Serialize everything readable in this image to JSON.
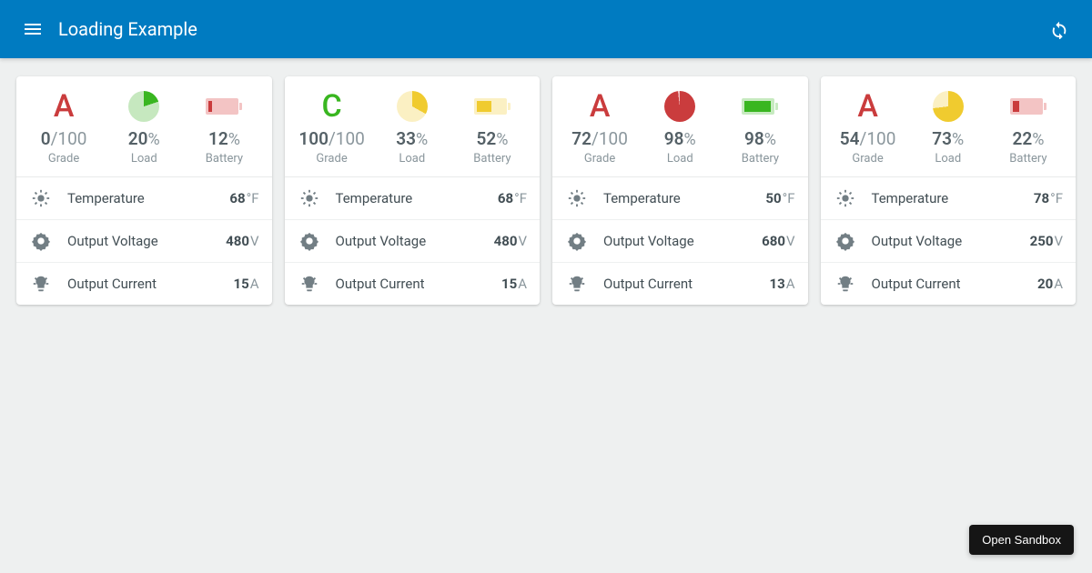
{
  "appbar": {
    "title": "Loading Example"
  },
  "sandbox_button": "Open Sandbox",
  "colors": {
    "red": "#ca3c3d",
    "green": "#39b620",
    "yellow": "#f0cb2f",
    "pieTrackGreen": "#c6e8bf",
    "pieTrackYellow": "#fbf0c3"
  },
  "labels": {
    "grade": "Grade",
    "load": "Load",
    "battery": "Battery",
    "temperature": "Temperature",
    "voltage": "Output Voltage",
    "current": "Output Current",
    "pct": "%",
    "maxGrade": "/100",
    "degF": "°F",
    "volt": "V",
    "amp": "A"
  },
  "cards": [
    {
      "grade": {
        "letter": "A",
        "color": "red",
        "value": 0
      },
      "load": {
        "percent": 20,
        "color": "green"
      },
      "battery": {
        "percent": 12,
        "color": "red"
      },
      "metrics": {
        "temperature": 68,
        "voltage": 480,
        "current": 15
      }
    },
    {
      "grade": {
        "letter": "C",
        "color": "green",
        "value": 100
      },
      "load": {
        "percent": 33,
        "color": "yellow"
      },
      "battery": {
        "percent": 52,
        "color": "yellow"
      },
      "metrics": {
        "temperature": 68,
        "voltage": 480,
        "current": 15
      }
    },
    {
      "grade": {
        "letter": "A",
        "color": "red",
        "value": 72
      },
      "load": {
        "percent": 98,
        "color": "red"
      },
      "battery": {
        "percent": 98,
        "color": "green"
      },
      "metrics": {
        "temperature": 50,
        "voltage": 680,
        "current": 13
      }
    },
    {
      "grade": {
        "letter": "A",
        "color": "red",
        "value": 54
      },
      "load": {
        "percent": 73,
        "color": "yellow"
      },
      "battery": {
        "percent": 22,
        "color": "red"
      },
      "metrics": {
        "temperature": 78,
        "voltage": 250,
        "current": 20
      }
    }
  ]
}
